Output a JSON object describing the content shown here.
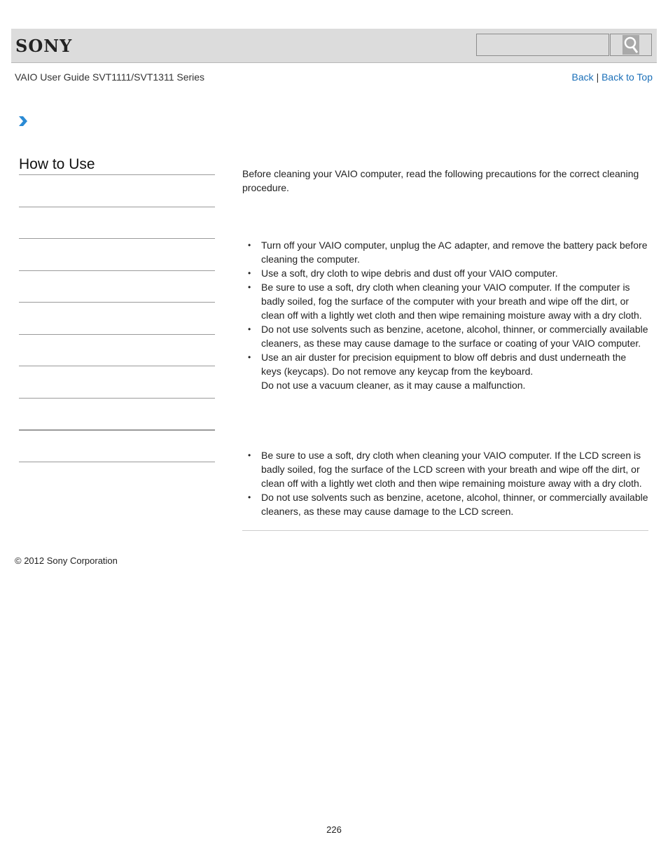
{
  "header": {
    "logo": "SONY",
    "search_placeholder": "",
    "search_button_icon": "search-icon"
  },
  "subheader": {
    "guide_title": "VAIO User Guide SVT1111/SVT1311 Series",
    "links": {
      "back": "Back",
      "separator": "|",
      "back_to_top": "Back to Top"
    },
    "link_color": "#1a6fb8"
  },
  "breadcrumb": {
    "icon": "chevron-right-icon",
    "accent_color": "#2a8ad4"
  },
  "sidebar": {
    "title": "How to Use",
    "items": [
      "",
      "",
      "",
      "",
      "",
      "",
      "",
      "",
      ""
    ]
  },
  "main": {
    "intro": "Before cleaning your VAIO computer, read the following precautions for the correct cleaning procedure.",
    "section1": {
      "items": [
        "Turn off your VAIO computer, unplug the AC adapter, and remove the battery pack before cleaning the computer.",
        "Use a soft, dry cloth to wipe debris and dust off your VAIO computer.",
        "Be sure to use a soft, dry cloth when cleaning your VAIO computer. If the computer is badly soiled, fog the surface of the computer with your breath and wipe off the dirt, or clean off with a lightly wet cloth and then wipe remaining moisture away with a dry cloth.",
        "Do not use solvents such as benzine, acetone, alcohol, thinner, or commercially available cleaners, as these may cause damage to the surface or coating of your VAIO computer.",
        "Use an air duster for precision equipment to blow off debris and dust underneath the keys (keycaps). Do not remove any keycap from the keyboard."
      ],
      "item5_extra": "Do not use a vacuum cleaner, as it may cause a malfunction."
    },
    "section2": {
      "items": [
        "Be sure to use a soft, dry cloth when cleaning your VAIO computer. If the LCD screen is badly soiled, fog the surface of the LCD screen with your breath and wipe off the dirt, or clean off with a lightly wet cloth and then wipe remaining moisture away with a dry cloth.",
        "Do not use solvents such as benzine, acetone, alcohol, thinner, or commercially available cleaners, as these may cause damage to the LCD screen."
      ]
    }
  },
  "footer": {
    "copyright": "© 2012 Sony Corporation",
    "page_number": "226"
  }
}
